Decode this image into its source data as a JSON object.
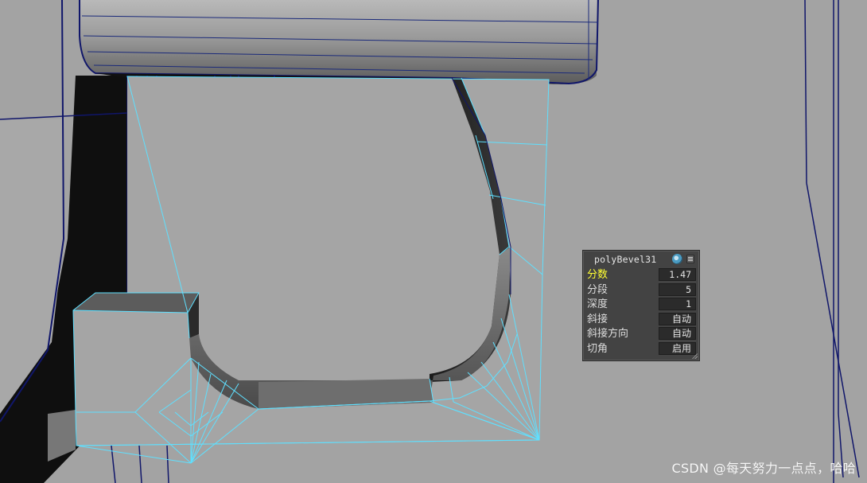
{
  "viewport": {
    "background": "#a3a3a3",
    "wire_color": "#0f1a6b",
    "selection_color": "#5fe0ff"
  },
  "panel": {
    "title": "polyBevel31",
    "title_icon": "node-ball-icon",
    "menu_icon": "hamburger-menu-icon",
    "rows": [
      {
        "label": "分数",
        "value": "1.47",
        "active": true
      },
      {
        "label": "分段",
        "value": "5",
        "active": false
      },
      {
        "label": "深度",
        "value": "1",
        "active": false
      },
      {
        "label": "斜接",
        "value": "自动",
        "active": false
      },
      {
        "label": "斜接方向",
        "value": "自动",
        "active": false
      },
      {
        "label": "切角",
        "value": "启用",
        "active": false
      }
    ]
  },
  "watermark": "CSDN @每天努力一点点，哈哈"
}
